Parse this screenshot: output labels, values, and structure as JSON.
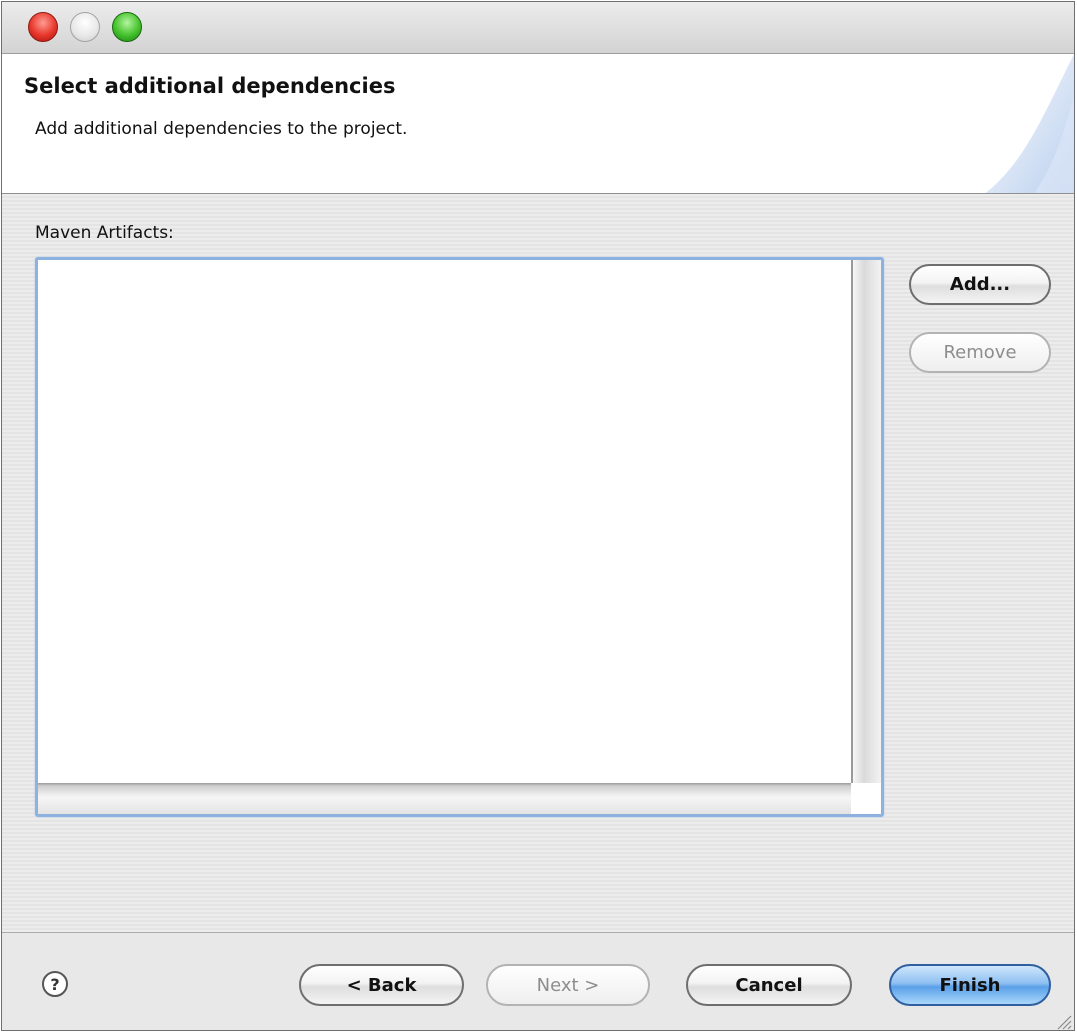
{
  "window": {
    "controls": [
      "close-icon",
      "minimize-icon",
      "zoom-icon"
    ]
  },
  "header": {
    "title": "Select additional dependencies",
    "subtitle": "Add additional dependencies to the project."
  },
  "artifacts": {
    "label": "Maven Artifacts:",
    "items": [],
    "add_label": "Add...",
    "remove_label": "Remove"
  },
  "footer": {
    "help_icon": "help-icon",
    "help_glyph": "?",
    "back_label": "< Back",
    "next_label": "Next >",
    "cancel_label": "Cancel",
    "finish_label": "Finish"
  },
  "colors": {
    "focus_ring": "#8db2df",
    "default_button": "#5aa0e8",
    "close": "#e8362b",
    "zoom": "#44c22c"
  }
}
